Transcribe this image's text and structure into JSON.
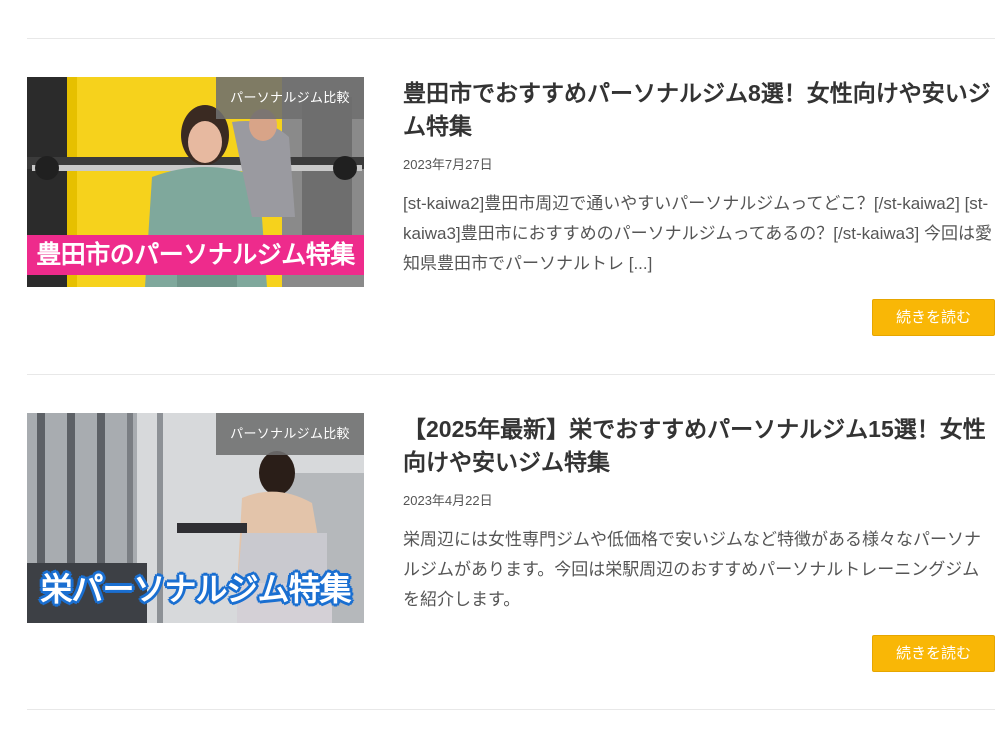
{
  "posts": [
    {
      "category": "パーソナルジム比較",
      "thumbnail_caption": "豊田市のパーソナルジム特集",
      "title": "豊田市でおすすめパーソナルジム8選！女性向けや安いジム特集",
      "date": "2023年7月27日",
      "excerpt": "[st-kaiwa2]豊田市周辺で通いやすいパーソナルジムってどこ？[/st-kaiwa2] [st-kaiwa3]豊田市におすすめのパーソナルジムってあるの？[/st-kaiwa3] 今回は愛知県豊田市でパーソナルトレ [...]",
      "read_more": "続きを読む"
    },
    {
      "category": "パーソナルジム比較",
      "thumbnail_caption": "栄パーソナルジム特集",
      "title": "【2025年最新】栄でおすすめパーソナルジム15選！女性向けや安いジム特集",
      "date": "2023年4月22日",
      "excerpt": "栄周辺には女性専門ジムや低価格で安いジムなど特徴がある様々なパーソナルジムがあります。今回は栄駅周辺のおすすめパーソナルトレーニングジムを紹介します。",
      "read_more": "続きを読む"
    }
  ],
  "colors": {
    "button": "#f9b706",
    "badge_overlay": "#6e6e6e",
    "pink_caption": "#ee2b8c",
    "blue_caption_outline": "#1a6fd1"
  }
}
